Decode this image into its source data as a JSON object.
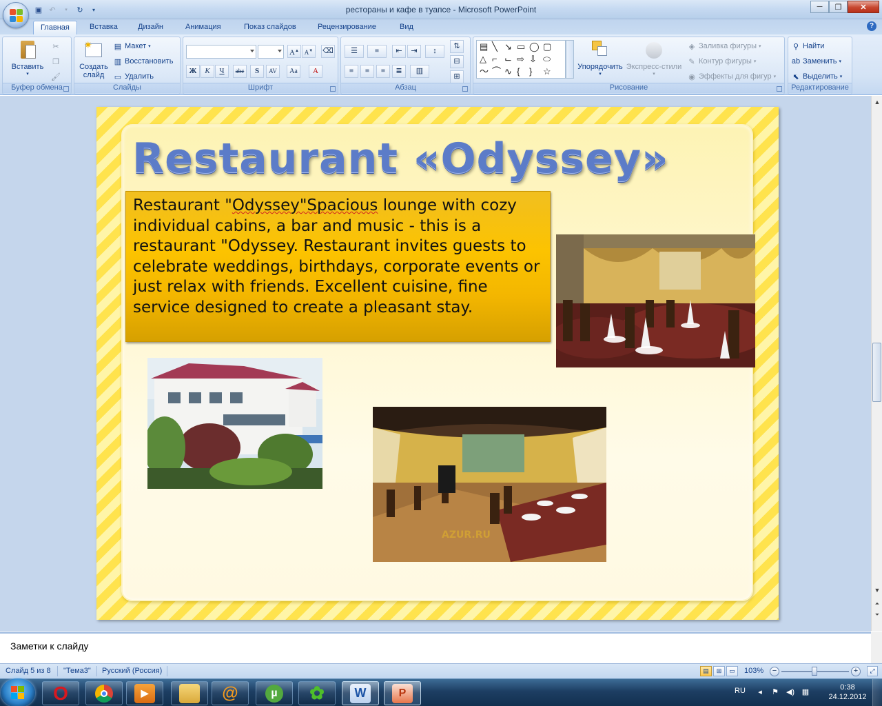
{
  "window": {
    "title": "рестораны и кафе в туапсе - Microsoft PowerPoint",
    "minimize": "─",
    "maximize": "❐",
    "close": "✕"
  },
  "tabs": [
    {
      "label": "Главная",
      "active": true
    },
    {
      "label": "Вставка"
    },
    {
      "label": "Дизайн"
    },
    {
      "label": "Анимация"
    },
    {
      "label": "Показ слайдов"
    },
    {
      "label": "Рецензирование"
    },
    {
      "label": "Вид"
    }
  ],
  "ribbon": {
    "clipboard": {
      "label": "Буфер обмена",
      "paste": "Вставить"
    },
    "slides": {
      "label": "Слайды",
      "new_slide_1": "Создать",
      "new_slide_2": "слайд",
      "layout": "Макет",
      "reset": "Восстановить",
      "delete": "Удалить"
    },
    "font": {
      "label": "Шрифт",
      "font_name": "",
      "font_size": ""
    },
    "paragraph": {
      "label": "Абзац"
    },
    "drawing": {
      "label": "Рисование",
      "arrange": "Упорядочить",
      "quick_styles": "Экспресс-стили",
      "shape_fill": "Заливка фигуры",
      "shape_outline": "Контур фигуры",
      "shape_effects": "Эффекты для фигур"
    },
    "editing": {
      "label": "Редактирование",
      "find": "Найти",
      "replace": "Заменить",
      "select": "Выделить"
    }
  },
  "slide": {
    "title": "Restaurant «Odyssey»",
    "body_prefix": "Restaurant \"",
    "body_misspelled_1": "Odyssey\"Spacious",
    "body_rest": " lounge with cozy individual cabins, a bar and music - this is a restaurant \"Odyssey. Restaurant invites guests to celebrate weddings, birthdays, corporate events or just relax with friends. Excellent cuisine, fine service designed to create a pleasant stay.",
    "watermark": "AZUR.RU"
  },
  "notes": {
    "placeholder": "Заметки к слайду"
  },
  "status": {
    "slide_counter": "Слайд 5 из 8",
    "theme": "\"Тема3\"",
    "language": "Русский (Россия)",
    "zoom": "103%"
  },
  "taskbar": {
    "lang": "RU",
    "time": "0:38",
    "date": "24.12.2012",
    "apps": [
      "opera-icon",
      "chrome-icon",
      "media-player-icon",
      "explorer-icon",
      "mail-agent-icon",
      "utorrent-icon",
      "icq-icon",
      "word-icon",
      "powerpoint-icon"
    ]
  },
  "colors": {
    "slide_stripe_a": "#ffe34d",
    "slide_stripe_b": "#fff5a8",
    "title_blue": "#5c7cc8",
    "textbox_gold": "#fcc300"
  }
}
